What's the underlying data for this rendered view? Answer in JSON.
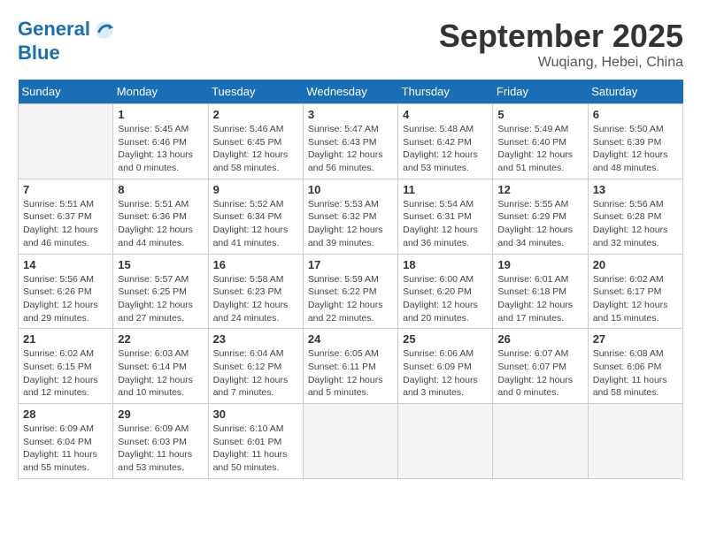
{
  "logo": {
    "line1": "General",
    "line2": "Blue"
  },
  "title": "September 2025",
  "location": "Wuqiang, Hebei, China",
  "weekdays": [
    "Sunday",
    "Monday",
    "Tuesday",
    "Wednesday",
    "Thursday",
    "Friday",
    "Saturday"
  ],
  "weeks": [
    [
      {
        "day": "",
        "info": ""
      },
      {
        "day": "1",
        "info": "Sunrise: 5:45 AM\nSunset: 6:46 PM\nDaylight: 13 hours\nand 0 minutes."
      },
      {
        "day": "2",
        "info": "Sunrise: 5:46 AM\nSunset: 6:45 PM\nDaylight: 12 hours\nand 58 minutes."
      },
      {
        "day": "3",
        "info": "Sunrise: 5:47 AM\nSunset: 6:43 PM\nDaylight: 12 hours\nand 56 minutes."
      },
      {
        "day": "4",
        "info": "Sunrise: 5:48 AM\nSunset: 6:42 PM\nDaylight: 12 hours\nand 53 minutes."
      },
      {
        "day": "5",
        "info": "Sunrise: 5:49 AM\nSunset: 6:40 PM\nDaylight: 12 hours\nand 51 minutes."
      },
      {
        "day": "6",
        "info": "Sunrise: 5:50 AM\nSunset: 6:39 PM\nDaylight: 12 hours\nand 48 minutes."
      }
    ],
    [
      {
        "day": "7",
        "info": "Sunrise: 5:51 AM\nSunset: 6:37 PM\nDaylight: 12 hours\nand 46 minutes."
      },
      {
        "day": "8",
        "info": "Sunrise: 5:51 AM\nSunset: 6:36 PM\nDaylight: 12 hours\nand 44 minutes."
      },
      {
        "day": "9",
        "info": "Sunrise: 5:52 AM\nSunset: 6:34 PM\nDaylight: 12 hours\nand 41 minutes."
      },
      {
        "day": "10",
        "info": "Sunrise: 5:53 AM\nSunset: 6:32 PM\nDaylight: 12 hours\nand 39 minutes."
      },
      {
        "day": "11",
        "info": "Sunrise: 5:54 AM\nSunset: 6:31 PM\nDaylight: 12 hours\nand 36 minutes."
      },
      {
        "day": "12",
        "info": "Sunrise: 5:55 AM\nSunset: 6:29 PM\nDaylight: 12 hours\nand 34 minutes."
      },
      {
        "day": "13",
        "info": "Sunrise: 5:56 AM\nSunset: 6:28 PM\nDaylight: 12 hours\nand 32 minutes."
      }
    ],
    [
      {
        "day": "14",
        "info": "Sunrise: 5:56 AM\nSunset: 6:26 PM\nDaylight: 12 hours\nand 29 minutes."
      },
      {
        "day": "15",
        "info": "Sunrise: 5:57 AM\nSunset: 6:25 PM\nDaylight: 12 hours\nand 27 minutes."
      },
      {
        "day": "16",
        "info": "Sunrise: 5:58 AM\nSunset: 6:23 PM\nDaylight: 12 hours\nand 24 minutes."
      },
      {
        "day": "17",
        "info": "Sunrise: 5:59 AM\nSunset: 6:22 PM\nDaylight: 12 hours\nand 22 minutes."
      },
      {
        "day": "18",
        "info": "Sunrise: 6:00 AM\nSunset: 6:20 PM\nDaylight: 12 hours\nand 20 minutes."
      },
      {
        "day": "19",
        "info": "Sunrise: 6:01 AM\nSunset: 6:18 PM\nDaylight: 12 hours\nand 17 minutes."
      },
      {
        "day": "20",
        "info": "Sunrise: 6:02 AM\nSunset: 6:17 PM\nDaylight: 12 hours\nand 15 minutes."
      }
    ],
    [
      {
        "day": "21",
        "info": "Sunrise: 6:02 AM\nSunset: 6:15 PM\nDaylight: 12 hours\nand 12 minutes."
      },
      {
        "day": "22",
        "info": "Sunrise: 6:03 AM\nSunset: 6:14 PM\nDaylight: 12 hours\nand 10 minutes."
      },
      {
        "day": "23",
        "info": "Sunrise: 6:04 AM\nSunset: 6:12 PM\nDaylight: 12 hours\nand 7 minutes."
      },
      {
        "day": "24",
        "info": "Sunrise: 6:05 AM\nSunset: 6:11 PM\nDaylight: 12 hours\nand 5 minutes."
      },
      {
        "day": "25",
        "info": "Sunrise: 6:06 AM\nSunset: 6:09 PM\nDaylight: 12 hours\nand 3 minutes."
      },
      {
        "day": "26",
        "info": "Sunrise: 6:07 AM\nSunset: 6:07 PM\nDaylight: 12 hours\nand 0 minutes."
      },
      {
        "day": "27",
        "info": "Sunrise: 6:08 AM\nSunset: 6:06 PM\nDaylight: 11 hours\nand 58 minutes."
      }
    ],
    [
      {
        "day": "28",
        "info": "Sunrise: 6:09 AM\nSunset: 6:04 PM\nDaylight: 11 hours\nand 55 minutes."
      },
      {
        "day": "29",
        "info": "Sunrise: 6:09 AM\nSunset: 6:03 PM\nDaylight: 11 hours\nand 53 minutes."
      },
      {
        "day": "30",
        "info": "Sunrise: 6:10 AM\nSunset: 6:01 PM\nDaylight: 11 hours\nand 50 minutes."
      },
      {
        "day": "",
        "info": ""
      },
      {
        "day": "",
        "info": ""
      },
      {
        "day": "",
        "info": ""
      },
      {
        "day": "",
        "info": ""
      }
    ]
  ]
}
